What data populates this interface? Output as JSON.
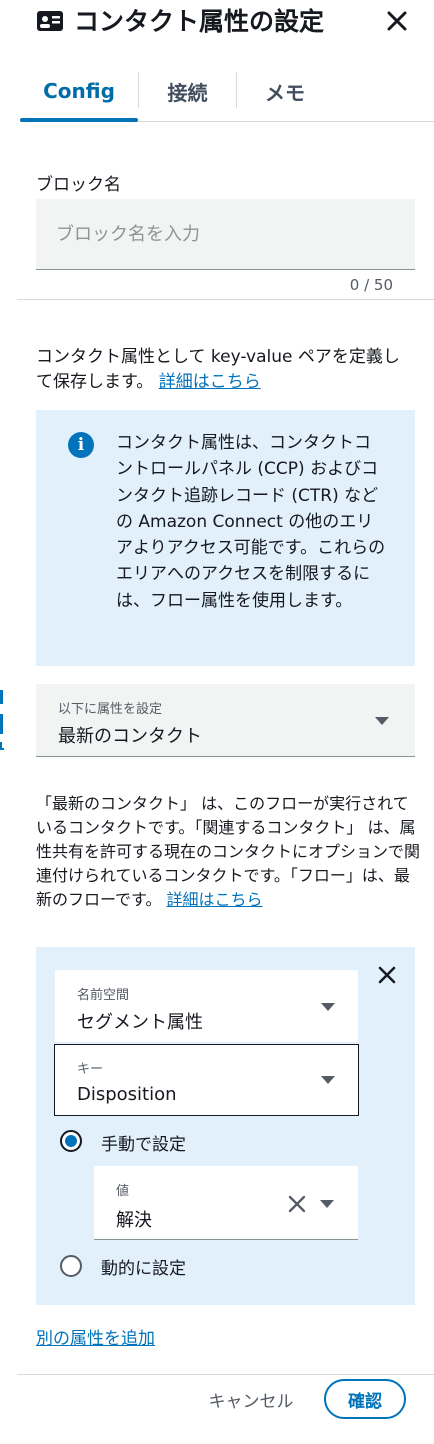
{
  "header": {
    "title": "コンタクト属性の設定",
    "icon": "contact-card-icon"
  },
  "tabs": [
    {
      "label": "Config",
      "active": true
    },
    {
      "label": "接続",
      "active": false
    },
    {
      "label": "メモ",
      "active": false
    }
  ],
  "block_name": {
    "label": "ブロック名",
    "placeholder": "ブロック名を入力",
    "value": "",
    "counter": "0 / 50"
  },
  "description": {
    "text": "コンタクト属性として key-value ペアを定義して保存します。",
    "link": "詳細はこちら"
  },
  "info": {
    "text": "コンタクト属性は、コンタクトコントロールパネル (CCP) およびコンタクト追跡レコード (CTR) などの Amazon Connect の他のエリアよりアクセス可能です。これらのエリアへのアクセスを制限するには、フロー属性を使用します。"
  },
  "set_target": {
    "caption": "以下に属性を設定",
    "value": "最新のコンタクト"
  },
  "target_description": {
    "text": "「最新のコンタクト」 は、このフローが実行されているコンタクトです。「関連するコンタクト」 は、属性共有を許可する現在のコンタクトにオプションで関連付けられているコンタクトです。「フロー」は、最新のフローです。",
    "link": "詳細はこちら"
  },
  "attribute": {
    "namespace": {
      "caption": "名前空間",
      "value": "セグメント属性"
    },
    "key": {
      "caption": "キー",
      "value": "Disposition"
    },
    "manual_label": "手動で設定",
    "value_field": {
      "caption": "値",
      "value": "解決"
    },
    "dynamic_label": "動的に設定",
    "selected_mode": "manual"
  },
  "add_attribute_link": "別の属性を追加",
  "footer": {
    "cancel": "キャンセル",
    "confirm": "確認"
  },
  "colors": {
    "accent": "#0073bb",
    "info_bg": "#e1f0fb",
    "field_bg": "#f2f3f3"
  }
}
